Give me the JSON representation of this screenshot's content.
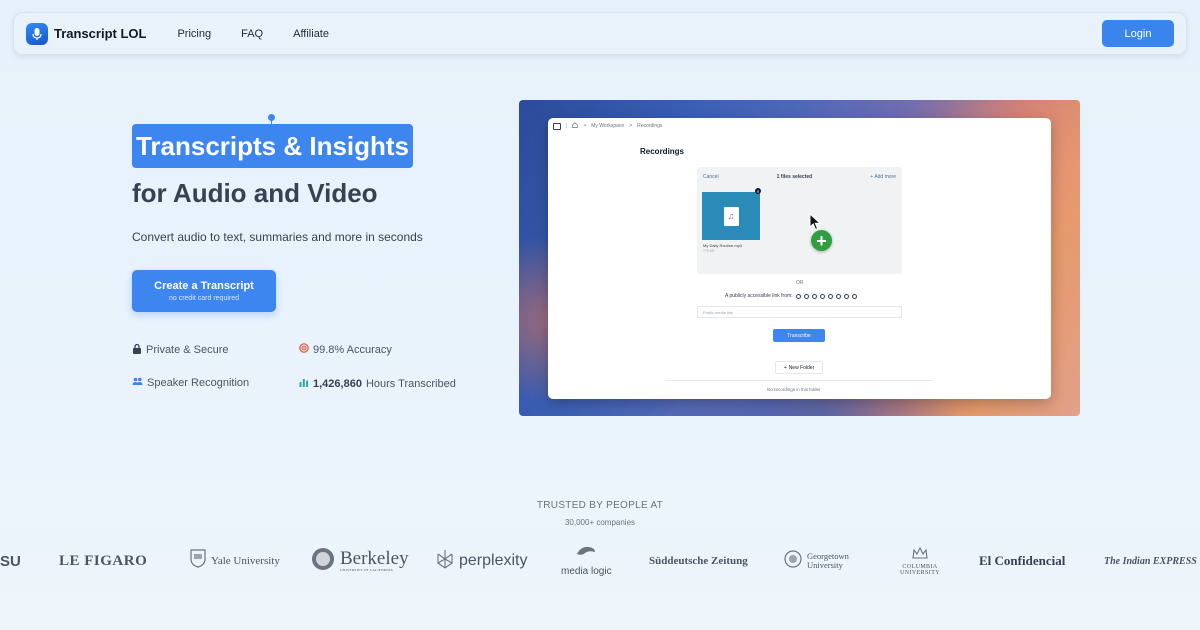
{
  "nav": {
    "brand": "Transcript LOL",
    "links": [
      "Pricing",
      "FAQ",
      "Affiliate"
    ],
    "login": "Login"
  },
  "hero": {
    "badge": "Transcripts & Insights",
    "subtitle": "for Audio and Video",
    "description": "Convert audio to text, summaries and more in seconds",
    "cta_main": "Create a Transcript",
    "cta_sub": "no credit card required"
  },
  "features": {
    "private": "Private & Secure",
    "accuracy": "99.8% Accuracy",
    "speaker": "Speaker Recognition",
    "hours_count": "1,426,860",
    "hours_label": "Hours Transcribed"
  },
  "app_preview": {
    "breadcrumb_workspace": "My Workspace",
    "breadcrumb_sep": ">",
    "breadcrumb_current": "Recordings",
    "title": "Recordings",
    "cancel": "Cancel",
    "files_selected": "1 files selected",
    "add_more": "+ Add more",
    "file_name": "My Daily Routine.mp3",
    "file_size": "770 KB",
    "or": "OR",
    "link_label": "A publicly accessible link from:",
    "input_placeholder": "Public media link",
    "transcribe": "Transcribe",
    "new_folder": "New Folder",
    "empty": "No recordings in this folder"
  },
  "trusted": {
    "title": "TRUSTED BY PEOPLE AT",
    "subtitle": "30,000+ companies",
    "logos": {
      "asu": "SU",
      "figaro": "LE FIGARO",
      "yale": "Yale University",
      "berkeley": "Berkeley",
      "berkeley_sub": "UNIVERSITY OF CALIFORNIA",
      "perplexity": "perplexity",
      "medialogic": "media logic",
      "sz": "Süddeutsche Zeitung",
      "georgetown_1": "Georgetown",
      "georgetown_2": "University",
      "columbia_1": "COLUMBIA",
      "columbia_2": "UNIVERSITY",
      "confidencial": "El Confidencial",
      "indian_express": "The Indian EXPRESS"
    }
  },
  "colors": {
    "accent": "#3d85ef",
    "background": "#e6f1fb"
  }
}
